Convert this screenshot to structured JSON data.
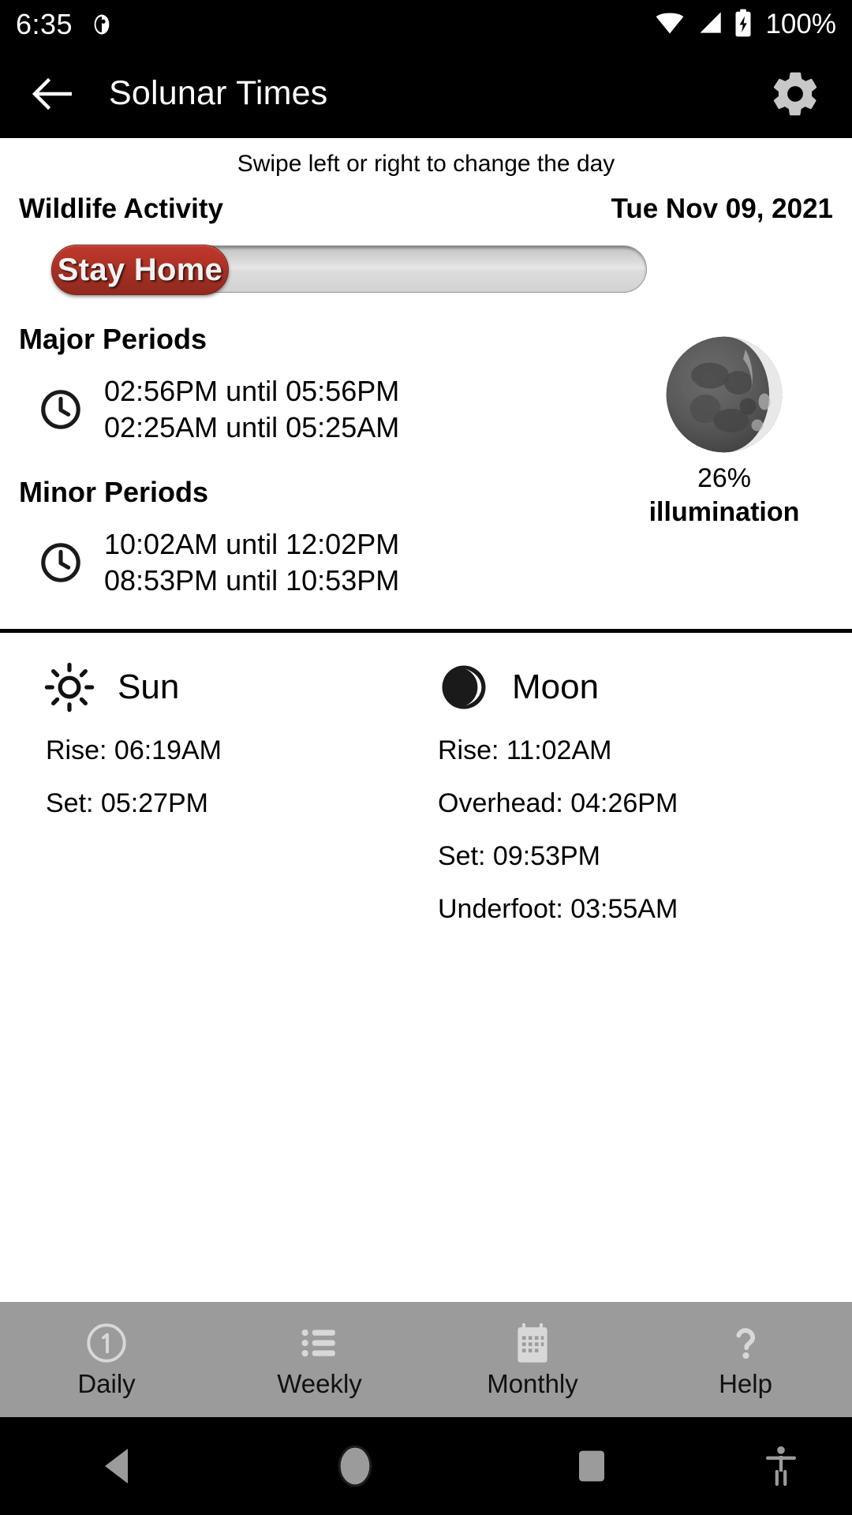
{
  "status_bar": {
    "time": "6:35",
    "battery_percent": "100%",
    "icons": [
      "notification-icon",
      "wifi-icon",
      "cellular-signal-icon",
      "battery-charging-icon"
    ]
  },
  "app_bar": {
    "title": "Solunar Times",
    "back_icon": "arrow-left-icon",
    "settings_icon": "gear-icon"
  },
  "main": {
    "swipe_hint": "Swipe left or right to change the day",
    "activity_label": "Wildlife Activity",
    "date": "Tue Nov 09, 2021",
    "activity_rating": {
      "label": "Stay Home",
      "fill_percent": 30,
      "fill_color": "#b03327",
      "track_color": "#dcdcdc"
    },
    "major": {
      "heading": "Major Periods",
      "line1": "02:56PM until 05:56PM",
      "line2": "02:25AM until 05:25AM"
    },
    "minor": {
      "heading": "Minor Periods",
      "line1": "10:02AM until 12:02PM",
      "line2": "08:53PM until 10:53PM"
    },
    "moon_phase": {
      "percent": "26%",
      "caption": "illumination",
      "illumination_value": 26,
      "phase_name": "waxing-crescent"
    },
    "sun": {
      "name": "Sun",
      "icon": "sun-icon",
      "rise": "Rise: 06:19AM",
      "set": "Set: 05:27PM"
    },
    "moon": {
      "name": "Moon",
      "icon": "moon-icon",
      "rise": "Rise: 11:02AM",
      "overhead": "Overhead: 04:26PM",
      "set": "Set: 09:53PM",
      "underfoot": "Underfoot: 03:55AM"
    }
  },
  "tabs": [
    {
      "label": "Daily",
      "icon": "number-one-circle-icon"
    },
    {
      "label": "Weekly",
      "icon": "list-icon"
    },
    {
      "label": "Monthly",
      "icon": "calendar-icon"
    },
    {
      "label": "Help",
      "icon": "question-mark-icon"
    }
  ],
  "nav_bar": {
    "back": "back-triangle-icon",
    "home": "home-circle-icon",
    "recents": "recents-square-icon",
    "accessibility": "accessibility-icon"
  }
}
